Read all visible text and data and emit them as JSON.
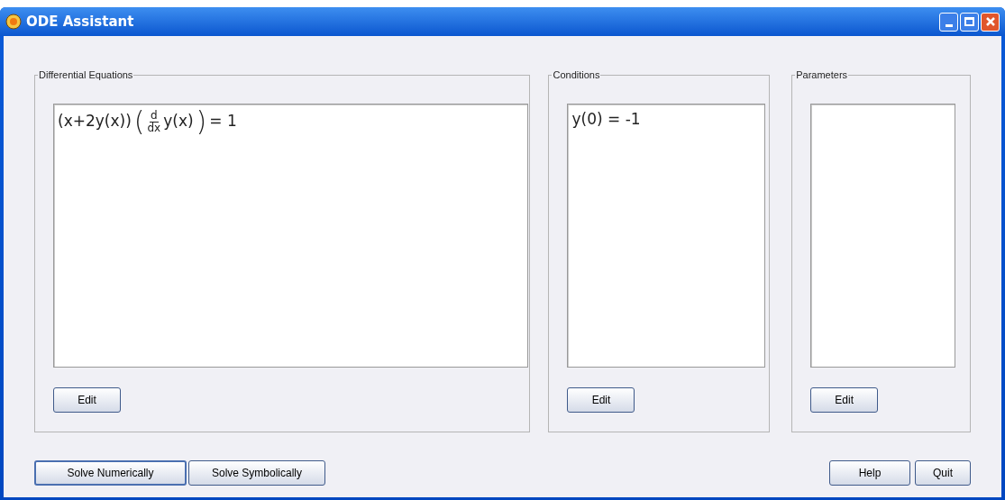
{
  "window": {
    "title": "ODE Assistant"
  },
  "panels": [
    {
      "title": "Differential Equations",
      "kind": "equation",
      "equation": {
        "factor": "(x+2y(x))",
        "open": "(",
        "num": "d",
        "den": "dx",
        "arg": "y(x)",
        "close": ")",
        "rhs": "= 1"
      },
      "button": "Edit"
    },
    {
      "title": "Conditions",
      "kind": "text",
      "text": "y(0) = -1",
      "button": "Edit"
    },
    {
      "title": "Parameters",
      "kind": "text",
      "button": "Edit"
    }
  ],
  "buttons_left": [
    {
      "label": "Solve Numerically",
      "default": true
    },
    {
      "label": "Solve Symbolically",
      "default": false
    }
  ],
  "buttons_right": [
    {
      "label": "Help",
      "default": false
    },
    {
      "label": "Quit",
      "default": false
    }
  ]
}
